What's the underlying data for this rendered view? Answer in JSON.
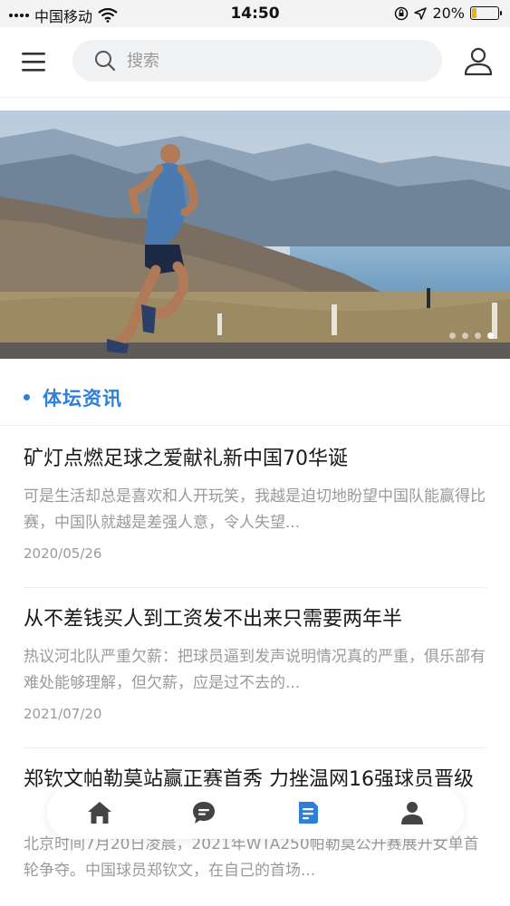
{
  "status_bar": {
    "carrier": "中国移动",
    "time": "14:50",
    "battery": "20%",
    "battery_level": 0.2,
    "battery_color": "#f0b400"
  },
  "header": {
    "menu_icon": "hamburger-menu-icon",
    "search_placeholder": "搜索",
    "search_icon": "search-icon",
    "user_icon": "user-profile-icon"
  },
  "banner": {
    "image": "runner-on-road-by-lake-mountains",
    "dots_count": 4,
    "active_dot": 4
  },
  "section": {
    "title": "体坛资讯",
    "accent_color": "#2f7ed8"
  },
  "news": [
    {
      "title": "矿灯点燃足球之爱献礼新中国70华诞",
      "summary": "可是生活却总是喜欢和人开玩笑，我越是迫切地盼望中国队能赢得比赛，中国队就越是差强人意，令人失望...",
      "date": "2020/05/26"
    },
    {
      "title": "从不差钱买人到工资发不出来只需要两年半",
      "summary": "热议河北队严重欠薪：把球员逼到发声说明情况真的严重，俱乐部有难处能够理解，但欠薪，应是过不去的...",
      "date": "2021/07/20"
    },
    {
      "title": "郑钦文帕勒莫站赢正赛首秀 力挫温网16强球员晋级",
      "summary": "北京时间7月20日凌晨，2021年WTA250帕勒莫公开赛展开女单首轮争夺。中国球员郑钦文，在自己的首场...",
      "date": ""
    }
  ],
  "tabbar": {
    "tabs": [
      {
        "icon": "home-icon",
        "active": false
      },
      {
        "icon": "chat-bubble-icon",
        "active": false
      },
      {
        "icon": "news-document-icon",
        "active": true
      },
      {
        "icon": "person-icon",
        "active": false
      }
    ],
    "active_color": "#2f7ed8",
    "inactive_color": "#444444"
  }
}
